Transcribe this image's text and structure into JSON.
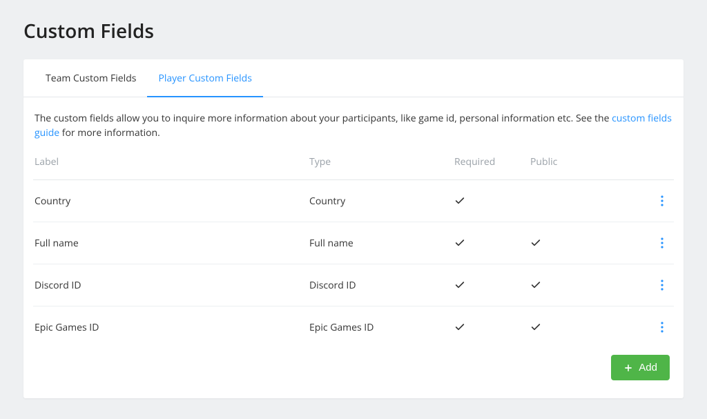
{
  "page_title": "Custom Fields",
  "tabs": [
    {
      "label": "Team Custom Fields",
      "active": false
    },
    {
      "label": "Player Custom Fields",
      "active": true
    }
  ],
  "intro": {
    "pre": "The custom fields allow you to inquire more information about your participants, like game id, personal information etc. See the ",
    "link": "custom fields guide",
    "post": " for more information."
  },
  "columns": {
    "label": "Label",
    "type": "Type",
    "required": "Required",
    "public": "Public"
  },
  "rows": [
    {
      "label": "Country",
      "type": "Country",
      "required": true,
      "public": false
    },
    {
      "label": "Full name",
      "type": "Full name",
      "required": true,
      "public": true
    },
    {
      "label": "Discord ID",
      "type": "Discord ID",
      "required": true,
      "public": true
    },
    {
      "label": "Epic Games ID",
      "type": "Epic Games ID",
      "required": true,
      "public": true
    }
  ],
  "add_label": "Add"
}
